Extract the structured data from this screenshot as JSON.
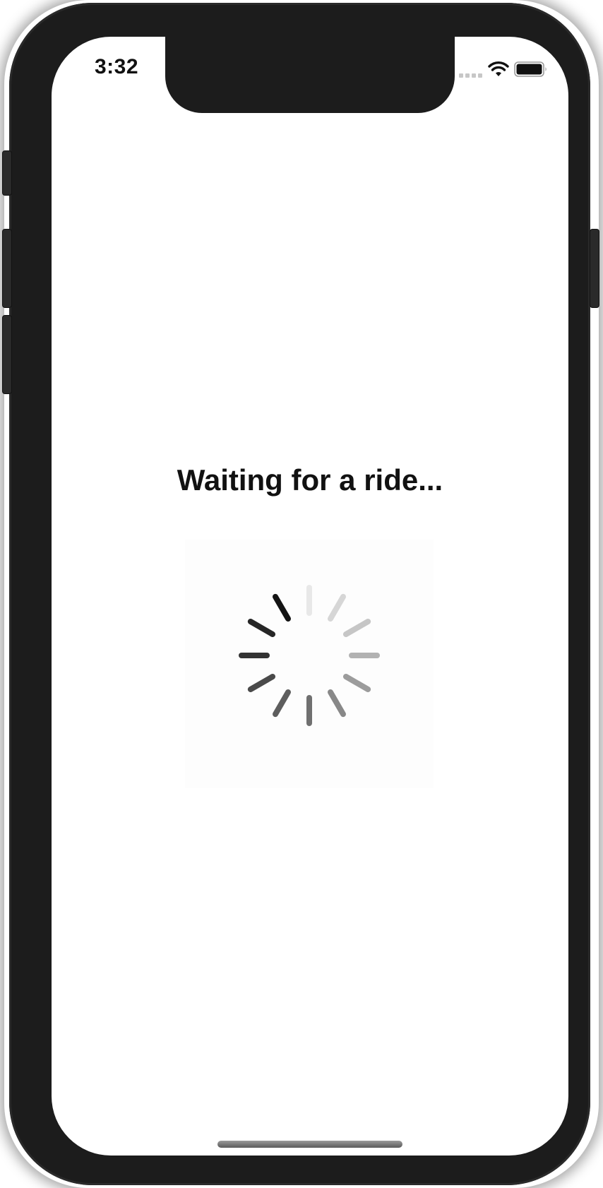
{
  "status_bar": {
    "time": "3:32",
    "signal_icon": "signal-bars-icon",
    "wifi_icon": "wifi-icon",
    "battery_icon": "battery-full-icon"
  },
  "main": {
    "title": "Waiting for a ride...",
    "spinner_icon": "activity-spinner-icon"
  },
  "colors": {
    "device": "#1c1c1c",
    "screen": "#ffffff",
    "text": "#111111"
  }
}
